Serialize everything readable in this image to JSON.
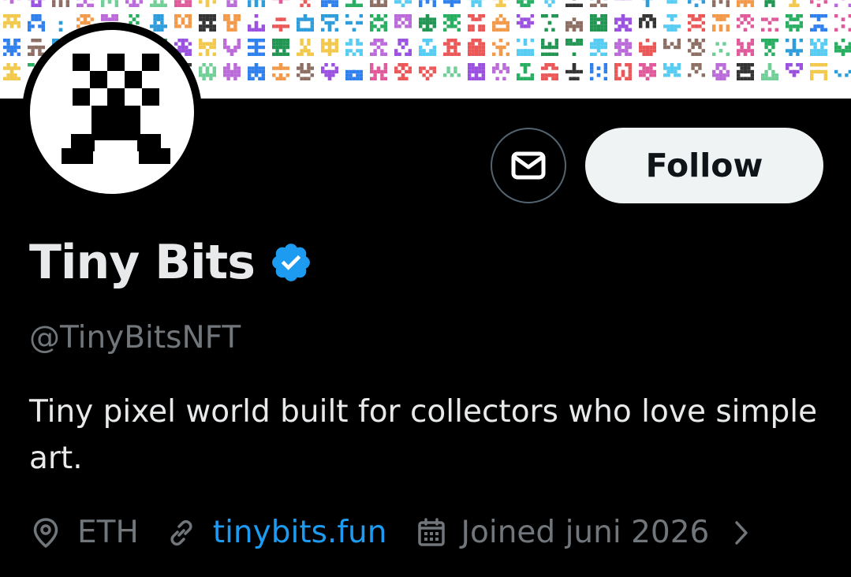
{
  "colors": {
    "background": "#000000",
    "text_primary": "#e7e9ea",
    "text_secondary": "#71767b",
    "link": "#1d9bf0",
    "verified_badge": "#1d9bf0",
    "follow_button_bg": "#eff3f4",
    "follow_button_text": "#0f1419"
  },
  "banner": {
    "sprite_palette": [
      "#2f80ed",
      "#9b51e0",
      "#eb5757",
      "#27ae60",
      "#f2c94c",
      "#f2994a",
      "#6fcf97",
      "#2d9cdb",
      "#bb6bd9",
      "#219653",
      "#e05a9b",
      "#333333",
      "#8d6e63",
      "#56ccf2"
    ]
  },
  "profile": {
    "display_name": "Tiny Bits",
    "verified": true,
    "handle": "@TinyBitsNFT",
    "bio": "Tiny pixel world built for collectors who love simple art.",
    "location": "ETH",
    "website": "tinybits.fun",
    "joined": "Joined juni 2026"
  },
  "actions": {
    "follow_label": "Follow"
  },
  "icons": {
    "message": "mail-icon",
    "verified": "verified-badge-icon",
    "location": "location-pin-icon",
    "link": "link-icon",
    "calendar": "calendar-icon",
    "more": "chevron-right-icon"
  }
}
